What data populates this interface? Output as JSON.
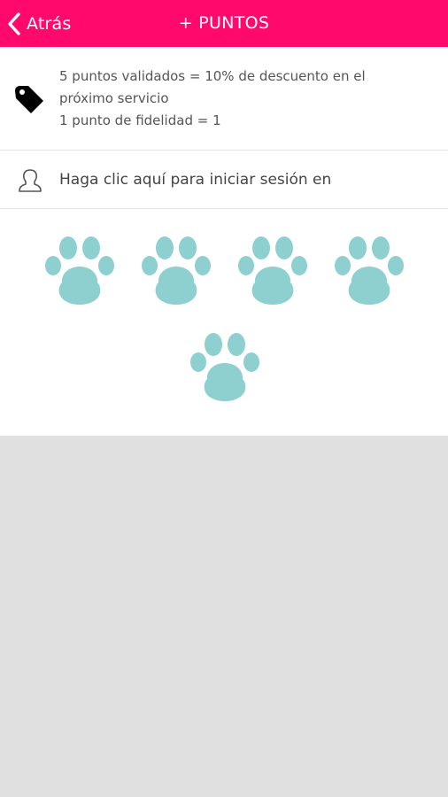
{
  "header": {
    "back_label": "Atrás",
    "title": "+ PUNTOS",
    "background_color": "#ff0a6c"
  },
  "info": {
    "icon": "price-tag-icon",
    "line1": "5 puntos validados = 10% de descuento en el",
    "line2": "próximo servicio",
    "line3": "1 punto de fidelidad = 1"
  },
  "login": {
    "icon": "user-outline-icon",
    "label": "Haga clic aquí para iniciar sesión en"
  },
  "stamps": {
    "icon": "paw-print-icon",
    "total": 5,
    "color": "#8ecfcf"
  }
}
